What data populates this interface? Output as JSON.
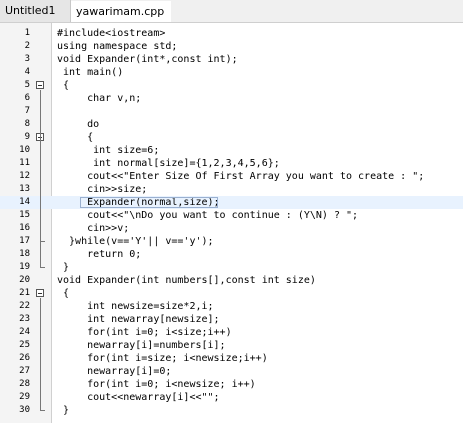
{
  "tabs": [
    {
      "label": "Untitled1",
      "active": false
    },
    {
      "label": "yawarimam.cpp",
      "active": true
    }
  ],
  "current_line": 14,
  "lines": [
    {
      "n": "1",
      "text": "#include<iostream>"
    },
    {
      "n": "2",
      "text": "using namespace std;"
    },
    {
      "n": "3",
      "text": "void Expander(int*,const int);"
    },
    {
      "n": "4",
      "text": " int main()"
    },
    {
      "n": "5",
      "text": " {"
    },
    {
      "n": "6",
      "text": "     char v,n;"
    },
    {
      "n": "7",
      "text": ""
    },
    {
      "n": "8",
      "text": "     do"
    },
    {
      "n": "9",
      "text": "     {"
    },
    {
      "n": "10",
      "text": "      int size=6;"
    },
    {
      "n": "11",
      "text": "      int normal[size]={1,2,3,4,5,6};"
    },
    {
      "n": "12",
      "text": "     cout<<\"Enter Size Of First Array you want to create : \";"
    },
    {
      "n": "13",
      "text": "     cin>>size;"
    },
    {
      "n": "14",
      "text": "     Expander(normal,size);"
    },
    {
      "n": "15",
      "text": "     cout<<\"\\nDo you want to continue : (Y\\N) ? \";"
    },
    {
      "n": "16",
      "text": "     cin>>v;"
    },
    {
      "n": "17",
      "text": "  }while(v=='Y'|| v=='y');"
    },
    {
      "n": "18",
      "text": "     return 0;"
    },
    {
      "n": "19",
      "text": " }"
    },
    {
      "n": "20",
      "text": "void Expander(int numbers[],const int size)"
    },
    {
      "n": "21",
      "text": " {"
    },
    {
      "n": "22",
      "text": "     int newsize=size*2,i;"
    },
    {
      "n": "23",
      "text": "     int newarray[newsize];"
    },
    {
      "n": "24",
      "text": "     for(int i=0; i<size;i++)"
    },
    {
      "n": "25",
      "text": "     newarray[i]=numbers[i];"
    },
    {
      "n": "26",
      "text": "     for(int i=size; i<newsize;i++)"
    },
    {
      "n": "27",
      "text": "     newarray[i]=0;"
    },
    {
      "n": "28",
      "text": "     for(int i=0; i<newsize; i++)"
    },
    {
      "n": "29",
      "text": "     cout<<newarray[i]<<\"\";"
    },
    {
      "n": "30",
      "text": " }"
    }
  ],
  "fold_markers": [
    5,
    9,
    21
  ],
  "colors": {
    "keyword": "#000000",
    "preprocessor": "#008000",
    "string": "#0000ff",
    "operator": "#ff0000",
    "number": "#c000c0",
    "current_line_bg": "#e8f2fe"
  }
}
